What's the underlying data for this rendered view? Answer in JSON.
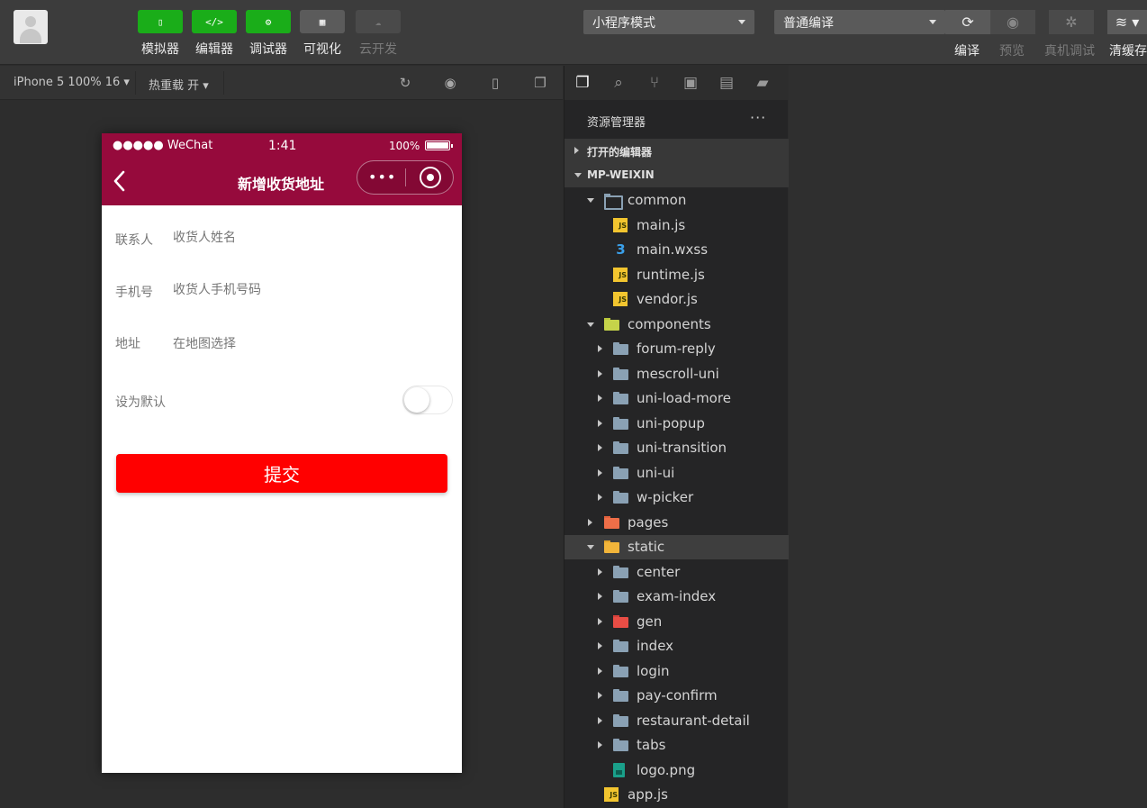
{
  "toolbar": {
    "tools": [
      {
        "label": "模拟器",
        "glyph": "▯",
        "style": "green"
      },
      {
        "label": "编辑器",
        "glyph": "</>",
        "style": "green"
      },
      {
        "label": "调试器",
        "glyph": "⚙",
        "style": "green"
      },
      {
        "label": "可视化",
        "glyph": "▦",
        "style": "gray"
      },
      {
        "label": "云开发",
        "glyph": "☁",
        "style": "dim"
      }
    ],
    "mode_select": "小程序模式",
    "compile_select": "普通编译",
    "compile_label": "编译",
    "preview_label": "预览",
    "real_debug_label": "真机调试",
    "clear_cache_label": "清缓存"
  },
  "subbar": {
    "device": "iPhone 5 100% 16 ▾",
    "hot_reload": "热重载 开 ▾"
  },
  "phone": {
    "status": {
      "signal": "●●●●● WeChat",
      "time": "1:41",
      "battery_pct": "100%"
    },
    "nav_title": "新增收货地址",
    "capsule_dots": "•••",
    "form": [
      {
        "label": "联系人",
        "placeholder": "收货人姓名"
      },
      {
        "label": "手机号",
        "placeholder": "收货人手机号码"
      },
      {
        "label": "地址",
        "value": "在地图选择"
      }
    ],
    "default_label": "设为默认",
    "default_on": false,
    "submit_label": "提交",
    "colors": {
      "nav_bg": "#960a3c",
      "submit_bg": "#ff0000"
    }
  },
  "explorer": {
    "title": "资源管理器",
    "more": "···",
    "open_editors": "打开的编辑器",
    "project": "MP-WEIXIN",
    "tree": [
      {
        "name": "common",
        "depth": 1,
        "type": "folder-open",
        "arrow": "down"
      },
      {
        "name": "main.js",
        "depth": 2,
        "type": "js",
        "arrow": "none"
      },
      {
        "name": "main.wxss",
        "depth": 2,
        "type": "css",
        "arrow": "none"
      },
      {
        "name": "runtime.js",
        "depth": 2,
        "type": "js",
        "arrow": "none"
      },
      {
        "name": "vendor.js",
        "depth": 2,
        "type": "js",
        "arrow": "none"
      },
      {
        "name": "components",
        "depth": 1,
        "type": "folder-comp",
        "arrow": "down"
      },
      {
        "name": "forum-reply",
        "depth": 2,
        "type": "folder",
        "arrow": "right"
      },
      {
        "name": "mescroll-uni",
        "depth": 2,
        "type": "folder",
        "arrow": "right"
      },
      {
        "name": "uni-load-more",
        "depth": 2,
        "type": "folder",
        "arrow": "right"
      },
      {
        "name": "uni-popup",
        "depth": 2,
        "type": "folder",
        "arrow": "right"
      },
      {
        "name": "uni-transition",
        "depth": 2,
        "type": "folder",
        "arrow": "right"
      },
      {
        "name": "uni-ui",
        "depth": 2,
        "type": "folder",
        "arrow": "right"
      },
      {
        "name": "w-picker",
        "depth": 2,
        "type": "folder",
        "arrow": "right"
      },
      {
        "name": "pages",
        "depth": 1,
        "type": "folder-pages",
        "arrow": "right"
      },
      {
        "name": "static",
        "depth": 1,
        "type": "folder-static",
        "arrow": "down",
        "selected": true
      },
      {
        "name": "center",
        "depth": 2,
        "type": "folder",
        "arrow": "right"
      },
      {
        "name": "exam-index",
        "depth": 2,
        "type": "folder",
        "arrow": "right"
      },
      {
        "name": "gen",
        "depth": 2,
        "type": "folder-gen",
        "arrow": "right"
      },
      {
        "name": "index",
        "depth": 2,
        "type": "folder",
        "arrow": "right"
      },
      {
        "name": "login",
        "depth": 2,
        "type": "folder",
        "arrow": "right"
      },
      {
        "name": "pay-confirm",
        "depth": 2,
        "type": "folder",
        "arrow": "right"
      },
      {
        "name": "restaurant-detail",
        "depth": 2,
        "type": "folder",
        "arrow": "right"
      },
      {
        "name": "tabs",
        "depth": 2,
        "type": "folder",
        "arrow": "right"
      },
      {
        "name": "logo.png",
        "depth": 2,
        "type": "png",
        "arrow": "none"
      },
      {
        "name": "app.js",
        "depth": 1,
        "type": "js",
        "arrow": "none"
      }
    ]
  }
}
